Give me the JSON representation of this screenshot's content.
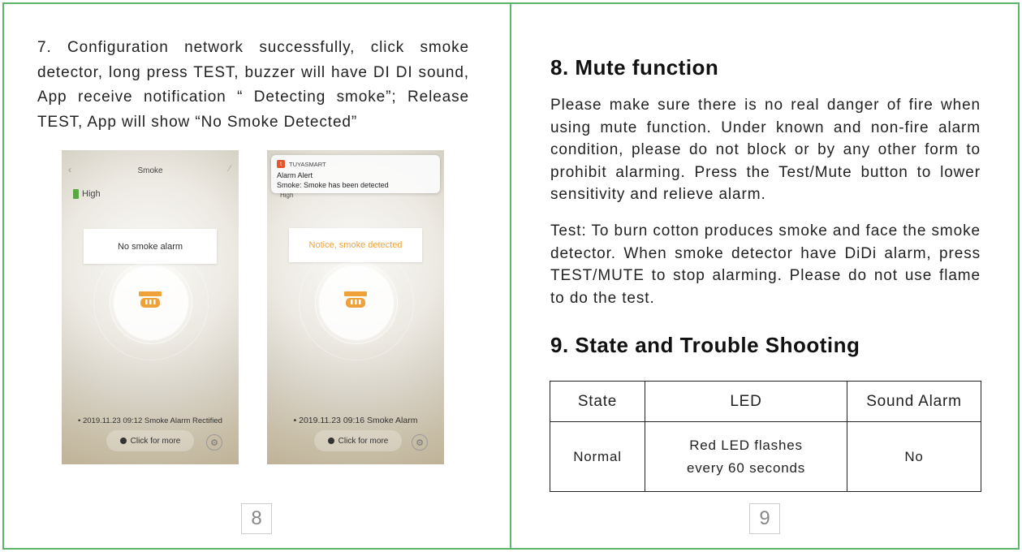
{
  "left_page": {
    "paragraph": "7. Configuration network successfully, click smoke detector, long press TEST, buzzer will have DI DI sound, App receive notification “ Detecting smoke”; Release TEST, App will show “No Smoke Detected”",
    "page_number": "8",
    "screenshot_1": {
      "nav_title": "Smoke",
      "battery_label": "High",
      "status_text": "No smoke alarm",
      "history_text": "• 2019.11.23 09:12 Smoke Alarm Rectified",
      "more_button": "Click for more",
      "icons": [
        "back-icon",
        "edit-icon",
        "battery-icon",
        "smoke-detector-icon",
        "clock-icon",
        "gear-icon"
      ]
    },
    "screenshot_2": {
      "notification": {
        "app_name": "TUYASMART",
        "title": "Alarm Alert",
        "body": "Smoke: Smoke has been detected"
      },
      "battery_label": "High",
      "status_text": "Notice, smoke detected",
      "history_text": "• 2019.11.23 09:16 Smoke Alarm",
      "more_button": "Click for more",
      "icons": [
        "app-logo-icon",
        "battery-icon",
        "smoke-detector-icon",
        "clock-icon",
        "gear-icon"
      ]
    }
  },
  "right_page": {
    "heading_mute": "8. Mute function",
    "mute_paragraph": "Please make sure there is no real danger of fire when using mute function. Under known and non-fire alarm condition, please do not block or by any other form to prohibit alarming. Press the Test/Mute button to lower sensitivity and relieve alarm.",
    "test_paragraph": "Test: To burn cotton produces smoke and face the smoke detector. When smoke detector have DiDi alarm, press TEST/MUTE to stop alarming. Please do not use flame to do the test.",
    "heading_state": "9. State and Trouble Shooting",
    "table": {
      "headers": [
        "State",
        "LED",
        "Sound Alarm"
      ],
      "rows": [
        {
          "state": "Normal",
          "led_line1": "Red LED flashes",
          "led_line2": "every 60 seconds",
          "sound": "No"
        }
      ]
    },
    "page_number": "9"
  },
  "colors": {
    "page_border": "#5bb56b",
    "alert_text": "#f0a23a",
    "detector_icon": "#f0a23a",
    "app_logo": "#e8542c"
  }
}
